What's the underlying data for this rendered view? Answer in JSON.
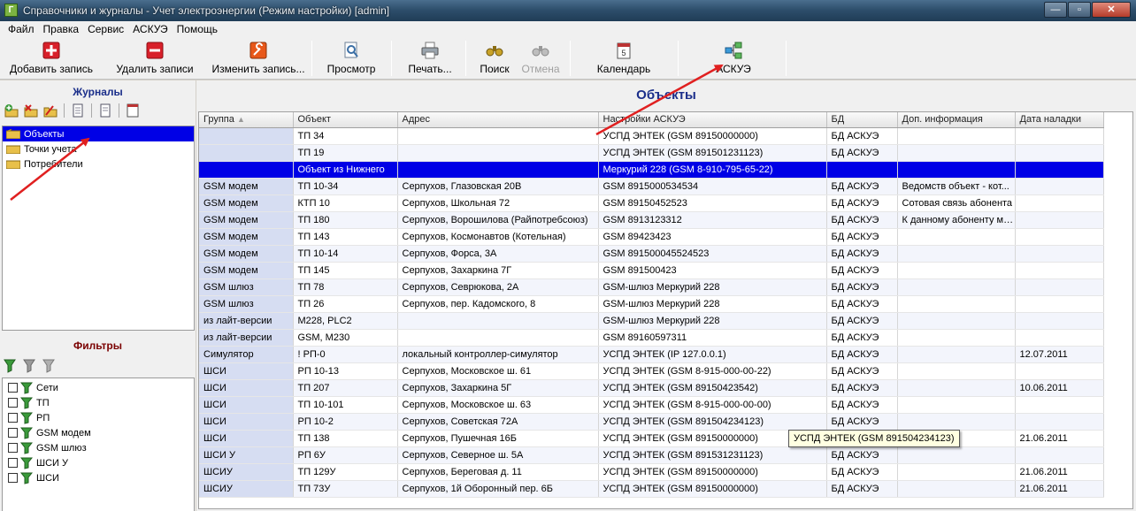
{
  "window": {
    "title": "Справочники и журналы - Учет электроэнергии (Режим настройки) [admin]",
    "app_icon": "Г"
  },
  "menu": [
    "Файл",
    "Правка",
    "Сервис",
    "АСКУЭ",
    "Помощь"
  ],
  "toolbar": {
    "add": "Добавить запись",
    "delete": "Удалить записи",
    "edit": "Изменить запись...",
    "preview": "Просмотр",
    "print": "Печать...",
    "search": "Поиск",
    "cancel": "Отмена",
    "calendar": "Календарь",
    "askue": "АСКУЭ"
  },
  "journals": {
    "title": "Журналы",
    "items": [
      "Объекты",
      "Точки учета",
      "Потребители"
    ]
  },
  "filters": {
    "title": "Фильтры",
    "items": [
      "Сети",
      "ТП",
      "РП",
      "GSM модем",
      "GSM шлюз",
      "ШСИ У",
      "ШСИ"
    ]
  },
  "main": {
    "title": "Объекты",
    "columns": [
      "Группа",
      "Объект",
      "Адрес",
      "Настройки АСКУЭ",
      "БД",
      "Доп. информация",
      "Дата наладки"
    ],
    "rows": [
      [
        "",
        "ТП 34",
        "",
        "УСПД ЭНТЕК (GSM 89150000000)",
        "БД АСКУЭ",
        "",
        ""
      ],
      [
        "",
        "ТП 19",
        "",
        "УСПД ЭНТЕК (GSM 891501231123)",
        "БД АСКУЭ",
        "",
        ""
      ],
      [
        "",
        "Объект из Нижнего",
        "",
        "Меркурий 228 (GSM 8-910-795-65-22)",
        "",
        "",
        ""
      ],
      [
        "GSM модем",
        "ТП 10-34",
        "Серпухов, Глазовская 20В",
        "GSM 8915000534534",
        "БД АСКУЭ",
        "Ведомств объект - кот...",
        ""
      ],
      [
        "GSM модем",
        "КТП 10",
        "Серпухов, Школьная 72",
        "GSM 89150452523",
        "БД АСКУЭ",
        "Сотовая связь абонента",
        ""
      ],
      [
        "GSM модем",
        "ТП 180",
        "Серпухов, Ворошилова (Райпотребсоюз)",
        "GSM 8913123312",
        "БД АСКУЭ",
        "К данному абоненту мо...",
        ""
      ],
      [
        "GSM модем",
        "ТП 143",
        "Серпухов, Космонавтов (Котельная)",
        "GSM 89423423",
        "БД АСКУЭ",
        "",
        ""
      ],
      [
        "GSM модем",
        "ТП 10-14",
        "Серпухов, Форса, 3А",
        "GSM 8915000455245​23",
        "БД АСКУЭ",
        "",
        ""
      ],
      [
        "GSM модем",
        "ТП 145",
        "Серпухов, Захаркина 7Г",
        "GSM 891500423",
        "БД АСКУЭ",
        "",
        ""
      ],
      [
        "GSM шлюз",
        "ТП 78",
        "Серпухов, Севрюкова, 2А",
        "GSM-шлюз Меркурий 228",
        "БД АСКУЭ",
        "",
        ""
      ],
      [
        "GSM шлюз",
        "ТП 26",
        "Серпухов, пер. Кадомского, 8",
        "GSM-шлюз Меркурий 228",
        "БД АСКУЭ",
        "",
        ""
      ],
      [
        "из лайт-версии",
        "М228, PLC2",
        "",
        "GSM-шлюз Меркурий 228",
        "БД АСКУЭ",
        "",
        ""
      ],
      [
        "из лайт-версии",
        "GSM, M230",
        "",
        "GSM 89160597311",
        "БД АСКУЭ",
        "",
        ""
      ],
      [
        "Симулятор",
        "! РП-0",
        "локальный контроллер-симулятор",
        "УСПД ЭНТЕК (IP 127.0.0.1)",
        "БД АСКУЭ",
        "",
        "12.07.2011"
      ],
      [
        "ШСИ",
        "РП 10-13",
        "Серпухов, Московское ш. 61",
        "УСПД ЭНТЕК (GSM 8-915-000-00-22)",
        "БД АСКУЭ",
        "",
        ""
      ],
      [
        "ШСИ",
        "ТП 207",
        "Серпухов, Захаркина 5Г",
        "УСПД ЭНТЕК (GSM 89150423542)",
        "БД АСКУЭ",
        "",
        "10.06.2011"
      ],
      [
        "ШСИ",
        "ТП 10-101",
        "Серпухов, Московское ш. 63",
        "УСПД ЭНТЕК (GSM 8-915-000-00-00)",
        "БД АСКУЭ",
        "",
        ""
      ],
      [
        "ШСИ",
        "РП 10-2",
        "Серпухов, Советская 72А",
        "УСПД ЭНТЕК (GSM 891504234123)",
        "БД АСКУЭ",
        "",
        ""
      ],
      [
        "ШСИ",
        "ТП 138",
        "Серпухов, Пушечная 16Б",
        "УСПД ЭНТЕК (GSM 89150000000)",
        "",
        "",
        "21.06.2011"
      ],
      [
        "ШСИ У",
        "РП 6У",
        "Серпухов, Северное ш. 5А",
        "УСПД ЭНТЕК (GSM 891531231123)",
        "БД АСКУЭ",
        "",
        ""
      ],
      [
        "ШСИУ",
        "ТП 129У",
        "Серпухов, Береговая д. 11",
        "УСПД ЭНТЕК (GSM 89150000000)",
        "БД АСКУЭ",
        "",
        "21.06.2011"
      ],
      [
        "ШСИУ",
        "ТП 73У",
        "Серпухов, 1й Оборонный пер. 6Б",
        "УСПД ЭНТЕК (GSM 89150000000)",
        "БД АСКУЭ",
        "",
        "21.06.2011"
      ]
    ],
    "selected_row": 2
  },
  "tooltip": "УСПД ЭНТЕК (GSM 891504234123)",
  "colors": {
    "selection": "#0000e6",
    "group_cell": "#d6ddf2",
    "title_blue": "#1a2e8a",
    "filters_red": "#7a0000",
    "arrow": "#e02020"
  }
}
